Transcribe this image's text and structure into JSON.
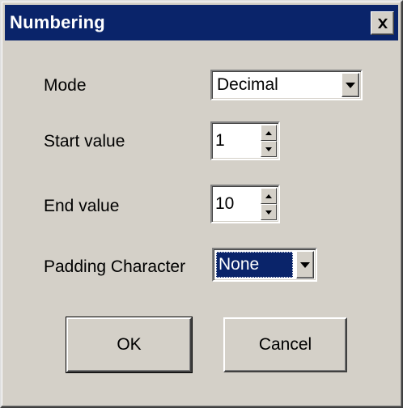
{
  "window": {
    "title": "Numbering",
    "close_label": "Close"
  },
  "form": {
    "mode": {
      "label": "Mode",
      "value": "Decimal"
    },
    "start": {
      "label": "Start value",
      "value": "1"
    },
    "end": {
      "label": "End value",
      "value": "10"
    },
    "padding": {
      "label": "Padding Character",
      "value": "None"
    }
  },
  "buttons": {
    "ok_label": "OK",
    "cancel_label": "Cancel"
  },
  "colors": {
    "titlebar": "#0a246a",
    "face": "#d4d0c8",
    "selection": "#0a246a"
  }
}
